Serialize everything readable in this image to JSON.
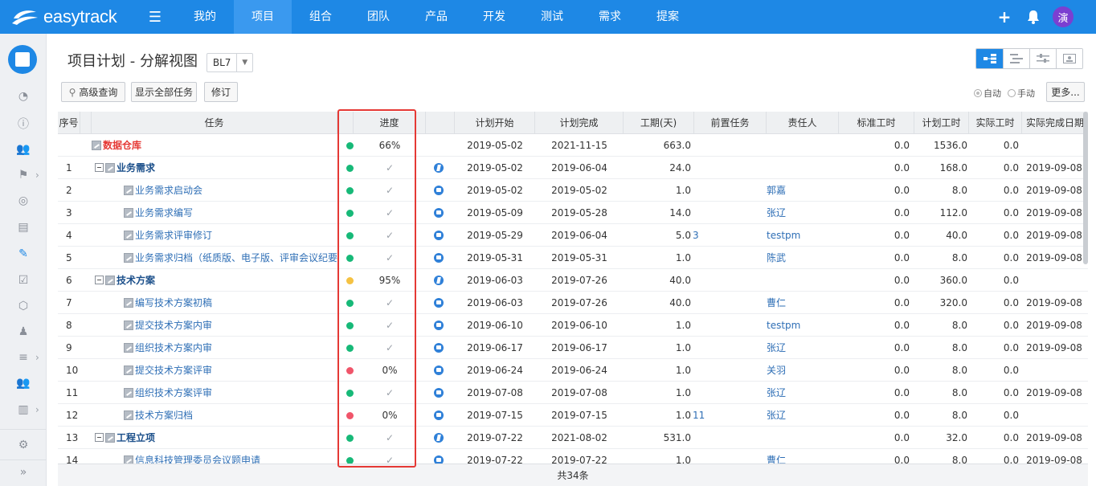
{
  "app": {
    "name": "easytrack",
    "user_initial": "演"
  },
  "nav": {
    "items": [
      "我的",
      "项目",
      "组合",
      "团队",
      "产品",
      "开发",
      "测试",
      "需求",
      "提案"
    ],
    "active": 1
  },
  "page": {
    "title": "项目计划 - 分解视图",
    "baseline": "BL7"
  },
  "toolbar": {
    "advanced_search": "高级查询",
    "show_all": "显示全部任务",
    "revise": "修订",
    "auto": "自动",
    "manual": "手动",
    "more": "更多..."
  },
  "columns": {
    "seq": "序号",
    "task": "任务",
    "progress": "进度",
    "plan_start": "计划开始",
    "plan_end": "计划完成",
    "duration": "工期(天)",
    "predecessor": "前置任务",
    "owner": "责任人",
    "std_hours": "标准工时",
    "plan_hours": "计划工时",
    "actual_hours": "实际工时",
    "actual_end": "实际完成日期"
  },
  "status_colors": {
    "green": "#17b978",
    "yellow": "#f5c242",
    "red": "#f0556a"
  },
  "rows": [
    {
      "seq": "",
      "task": "数据仓库",
      "level": 0,
      "type": "root",
      "status": "green",
      "progress": "66%",
      "start": "2019-05-02",
      "end": "2021-11-15",
      "duration": "663.0",
      "pred": "",
      "owner": "",
      "std": "0.0",
      "plan": "1536.0",
      "actual": "0.0",
      "actual_end": ""
    },
    {
      "seq": "1",
      "task": "业务需求",
      "level": 1,
      "type": "group",
      "status": "green",
      "progress": "✓",
      "start": "2019-05-02",
      "end": "2019-06-04",
      "duration": "24.0",
      "pred": "",
      "owner": "",
      "std": "0.0",
      "plan": "168.0",
      "actual": "0.0",
      "actual_end": "2019-09-08"
    },
    {
      "seq": "2",
      "task": "业务需求启动会",
      "level": 2,
      "type": "task",
      "status": "green",
      "progress": "✓",
      "start": "2019-05-02",
      "end": "2019-05-02",
      "duration": "1.0",
      "pred": "",
      "owner": "郭嘉",
      "std": "0.0",
      "plan": "8.0",
      "actual": "0.0",
      "actual_end": "2019-09-08"
    },
    {
      "seq": "3",
      "task": "业务需求编写",
      "level": 2,
      "type": "task",
      "status": "green",
      "progress": "✓",
      "start": "2019-05-09",
      "end": "2019-05-28",
      "duration": "14.0",
      "pred": "",
      "owner": "张辽",
      "std": "0.0",
      "plan": "112.0",
      "actual": "0.0",
      "actual_end": "2019-09-08"
    },
    {
      "seq": "4",
      "task": "业务需求评审修订",
      "level": 2,
      "type": "task",
      "status": "green",
      "progress": "✓",
      "start": "2019-05-29",
      "end": "2019-06-04",
      "duration": "5.0",
      "pred": "3",
      "owner": "testpm",
      "std": "0.0",
      "plan": "40.0",
      "actual": "0.0",
      "actual_end": "2019-09-08"
    },
    {
      "seq": "5",
      "task": "业务需求归档（纸质版、电子版、评审会议纪要、评",
      "level": 2,
      "type": "task",
      "status": "green",
      "progress": "✓",
      "start": "2019-05-31",
      "end": "2019-05-31",
      "duration": "1.0",
      "pred": "",
      "owner": "陈武",
      "std": "0.0",
      "plan": "8.0",
      "actual": "0.0",
      "actual_end": "2019-09-08"
    },
    {
      "seq": "6",
      "task": "技术方案",
      "level": 1,
      "type": "group",
      "status": "yellow",
      "progress": "95%",
      "start": "2019-06-03",
      "end": "2019-07-26",
      "duration": "40.0",
      "pred": "",
      "owner": "",
      "std": "0.0",
      "plan": "360.0",
      "actual": "0.0",
      "actual_end": ""
    },
    {
      "seq": "7",
      "task": "编写技术方案初稿",
      "level": 2,
      "type": "task",
      "status": "green",
      "progress": "✓",
      "start": "2019-06-03",
      "end": "2019-07-26",
      "duration": "40.0",
      "pred": "",
      "owner": "曹仁",
      "std": "0.0",
      "plan": "320.0",
      "actual": "0.0",
      "actual_end": "2019-09-08"
    },
    {
      "seq": "8",
      "task": "提交技术方案内审",
      "level": 2,
      "type": "task",
      "status": "green",
      "progress": "✓",
      "start": "2019-06-10",
      "end": "2019-06-10",
      "duration": "1.0",
      "pred": "",
      "owner": "testpm",
      "std": "0.0",
      "plan": "8.0",
      "actual": "0.0",
      "actual_end": "2019-09-08"
    },
    {
      "seq": "9",
      "task": "组织技术方案内审",
      "level": 2,
      "type": "task",
      "status": "green",
      "progress": "✓",
      "start": "2019-06-17",
      "end": "2019-06-17",
      "duration": "1.0",
      "pred": "",
      "owner": "张辽",
      "std": "0.0",
      "plan": "8.0",
      "actual": "0.0",
      "actual_end": "2019-09-08"
    },
    {
      "seq": "10",
      "task": "提交技术方案评审",
      "level": 2,
      "type": "task",
      "status": "red",
      "progress": "0%",
      "start": "2019-06-24",
      "end": "2019-06-24",
      "duration": "1.0",
      "pred": "",
      "owner": "关羽",
      "std": "0.0",
      "plan": "8.0",
      "actual": "0.0",
      "actual_end": ""
    },
    {
      "seq": "11",
      "task": "组织技术方案评审",
      "level": 2,
      "type": "task",
      "status": "green",
      "progress": "✓",
      "start": "2019-07-08",
      "end": "2019-07-08",
      "duration": "1.0",
      "pred": "",
      "owner": "张辽",
      "std": "0.0",
      "plan": "8.0",
      "actual": "0.0",
      "actual_end": "2019-09-08"
    },
    {
      "seq": "12",
      "task": "技术方案归档",
      "level": 2,
      "type": "task",
      "status": "red",
      "progress": "0%",
      "start": "2019-07-15",
      "end": "2019-07-15",
      "duration": "1.0",
      "pred": "11",
      "owner": "张辽",
      "std": "0.0",
      "plan": "8.0",
      "actual": "0.0",
      "actual_end": ""
    },
    {
      "seq": "13",
      "task": "工程立项",
      "level": 1,
      "type": "group",
      "status": "green",
      "progress": "✓",
      "start": "2019-07-22",
      "end": "2021-08-02",
      "duration": "531.0",
      "pred": "",
      "owner": "",
      "std": "0.0",
      "plan": "32.0",
      "actual": "0.0",
      "actual_end": "2019-09-08"
    },
    {
      "seq": "14",
      "task": "信息科技管理委员会议题申请",
      "level": 2,
      "type": "task",
      "status": "green",
      "progress": "✓",
      "start": "2019-07-22",
      "end": "2019-07-22",
      "duration": "1.0",
      "pred": "",
      "owner": "曹仁",
      "std": "0.0",
      "plan": "8.0",
      "actual": "0.0",
      "actual_end": "2019-09-08"
    }
  ],
  "footer": {
    "total": "共34条"
  }
}
